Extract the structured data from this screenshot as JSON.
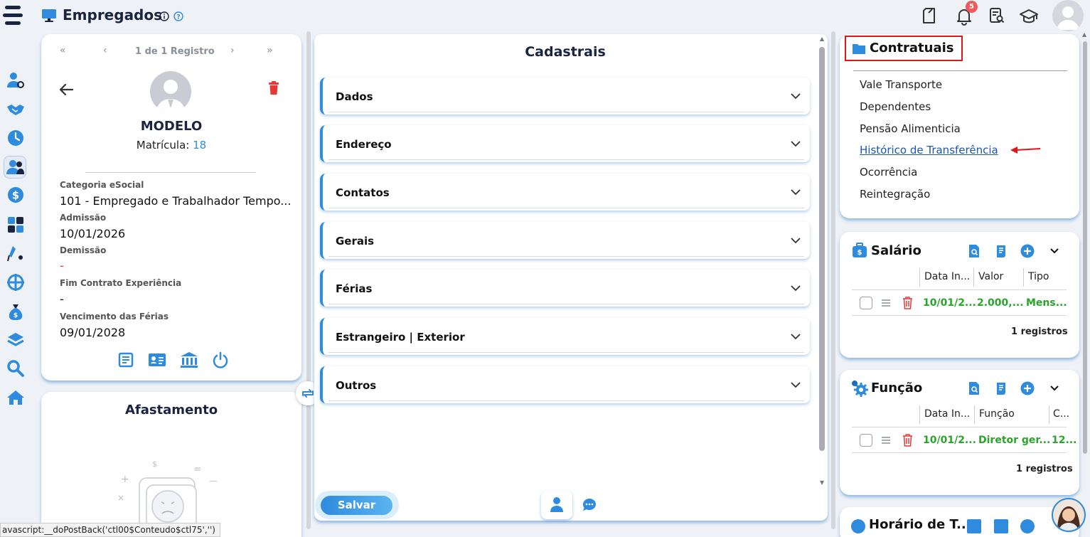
{
  "header": {
    "title": "Empregados",
    "notification_count": "5"
  },
  "employee": {
    "pager_text": "1 de 1 Registro",
    "first": "«",
    "prev": "‹",
    "next": "›",
    "last": "»",
    "name": "MODELO",
    "matricula_label": "Matrícula:",
    "matricula_value": "18",
    "fields": [
      {
        "label": "Categoria eSocial",
        "value": "101 - Empregado e Trabalhador Tempo..."
      },
      {
        "label": "Admissão",
        "value": "10/01/2026"
      },
      {
        "label": "Demissão",
        "value": "-"
      },
      {
        "label": "Fim Contrato Experiência",
        "value": "-"
      },
      {
        "label": "Vencimento das Férias",
        "value": "09/01/2028"
      }
    ]
  },
  "afastamento": {
    "title": "Afastamento"
  },
  "cadastrais": {
    "title": "Cadastrais",
    "sections": [
      "Dados",
      "Endereço",
      "Contatos",
      "Gerais",
      "Férias",
      "Estrangeiro | Exterior",
      "Outros"
    ],
    "save_label": "Salvar"
  },
  "contratuais": {
    "title": "Contratuais",
    "links": [
      "Vale Transporte",
      "Dependentes",
      "Pensão Alimenticia",
      "Histórico de Transferência",
      "Ocorrência",
      "Reintegração"
    ]
  },
  "salario": {
    "title": "Salário",
    "columns": [
      "Data In...",
      "Valor",
      "Tipo"
    ],
    "rows": [
      [
        "10/01/2...",
        "2.000,...",
        "Mens..."
      ]
    ],
    "count": "1 registros"
  },
  "funcao": {
    "title": "Função",
    "columns": [
      "Data In...",
      "Função",
      "C..."
    ],
    "rows": [
      [
        "10/01/2...",
        "Diretor ger...",
        "12..."
      ]
    ],
    "count": "1 registros"
  },
  "horario": {
    "title": "Horário de T..."
  },
  "status_bar": {
    "text": "avascript:__doPostBack('ctl00$Conteudo$ctl75','')"
  },
  "colors": {
    "accent": "#2e8bde",
    "brand_dark": "#1a2340",
    "danger": "#e53935",
    "success": "#2aa52a",
    "highlight_box": "#e0161b"
  }
}
